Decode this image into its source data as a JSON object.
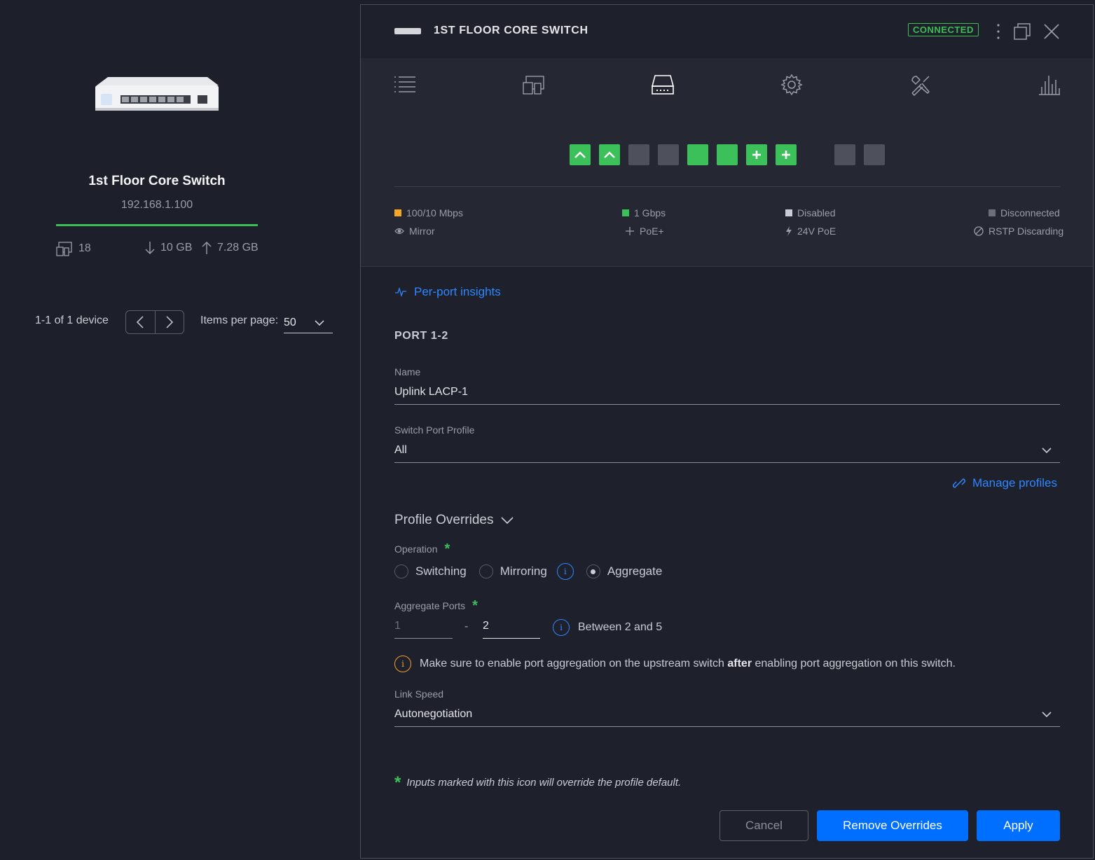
{
  "device": {
    "name": "1st Floor Core Switch",
    "ip": "192.168.1.100",
    "clients": "18",
    "download": "10 GB",
    "upload": "7.28 GB"
  },
  "pagination": {
    "summary": "1-1 of 1 device",
    "items_per_page_label": "Items per page:",
    "items_per_page_value": "50"
  },
  "panel": {
    "title": "1ST FLOOR CORE SWITCH",
    "status": "CONNECTED",
    "tabs": [
      "details-list",
      "clients",
      "ports",
      "settings",
      "tools",
      "statistics"
    ],
    "active_tab": "ports"
  },
  "ports": [
    {
      "state": "1 Gbps",
      "icon": "uplink"
    },
    {
      "state": "1 Gbps",
      "icon": "uplink"
    },
    {
      "state": "Disconnected",
      "icon": ""
    },
    {
      "state": "Disconnected",
      "icon": ""
    },
    {
      "state": "1 Gbps",
      "icon": ""
    },
    {
      "state": "1 Gbps",
      "icon": ""
    },
    {
      "state": "1 Gbps",
      "icon": "poe-plus"
    },
    {
      "state": "1 Gbps",
      "icon": "poe-plus"
    },
    {
      "state": "Disconnected",
      "icon": ""
    },
    {
      "state": "Disconnected",
      "icon": ""
    }
  ],
  "legend": {
    "speed_100": "100/10 Mbps",
    "speed_1g": "1 Gbps",
    "disabled": "Disabled",
    "disconnected": "Disconnected",
    "mirror": "Mirror",
    "poe_plus": "PoE+",
    "poe_24v": "24V PoE",
    "rstp": "RSTP Discarding"
  },
  "colors": {
    "speed_100": "#f5a623",
    "speed_1g": "#3cc15a",
    "disabled": "#c9ccd4",
    "disconnected": "#6b6f7a",
    "accent": "#006fff",
    "connected": "#3cbd55"
  },
  "form": {
    "insights_link": "Per-port insights",
    "port_heading": "PORT 1-2",
    "name_label": "Name",
    "name_value": "Uplink LACP-1",
    "profile_label": "Switch Port Profile",
    "profile_value": "All",
    "manage_profiles": "Manage profiles",
    "overrides_heading": "Profile Overrides",
    "operation_label": "Operation",
    "operations": [
      "Switching",
      "Mirroring",
      "Aggregate"
    ],
    "operation_selected": "Aggregate",
    "aggregate_label": "Aggregate Ports",
    "aggregate_from_placeholder": "1",
    "aggregate_dash": "-",
    "aggregate_to_value": "2",
    "aggregate_hint": "Between 2 and 5",
    "warning_pre": "Make sure to enable port aggregation on the upstream switch ",
    "warning_bold": "after",
    "warning_post": " enabling port aggregation on this switch.",
    "link_speed_label": "Link Speed",
    "link_speed_value": "Autonegotiation",
    "footnote": "Inputs marked with this icon will override the profile default."
  },
  "buttons": {
    "cancel": "Cancel",
    "remove": "Remove Overrides",
    "apply": "Apply"
  }
}
